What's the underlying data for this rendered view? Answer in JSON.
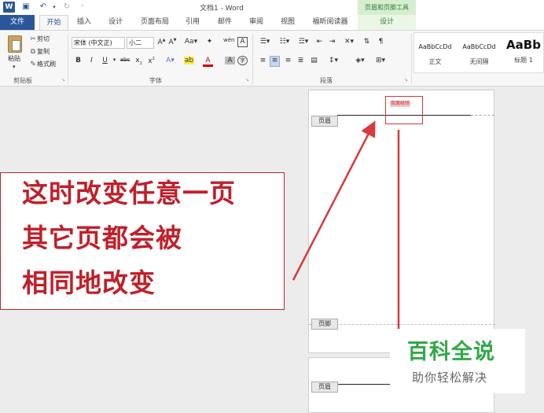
{
  "titlebar": {
    "title": "文档1 - Word",
    "contextual_group": "页眉和页脚工具"
  },
  "tabs": [
    "文件",
    "开始",
    "插入",
    "设计",
    "页面布局",
    "引用",
    "邮件",
    "审阅",
    "视图",
    "福昕阅读器",
    "设计"
  ],
  "ribbon": {
    "clipboard": {
      "paste": "粘贴",
      "cut": "剪切",
      "copy": "复制",
      "format_painter": "格式刷",
      "label": "剪贴板"
    },
    "font": {
      "font_name": "宋体 (中文正)",
      "font_size": "小二",
      "label": "字体"
    },
    "paragraph": {
      "label": "段落"
    },
    "styles": [
      {
        "sample": "AaBbCcDd",
        "name": "正文"
      },
      {
        "sample": "AaBbCcDd",
        "name": "无间隔"
      },
      {
        "sample": "AaBb",
        "name": "标题 1"
      }
    ]
  },
  "document": {
    "header_tag": "页眉",
    "footer_tag": "页脚",
    "header_text": "百度经验"
  },
  "callout": {
    "lines": [
      "这时改变任意一页",
      "其它页都会被",
      "相同地改变"
    ]
  },
  "brand": {
    "name": "百科全说",
    "slogan": "助你轻松解决"
  },
  "colors": {
    "word_blue": "#2b579a",
    "annotation_red": "#c0202a",
    "brand_green": "#31a846"
  }
}
